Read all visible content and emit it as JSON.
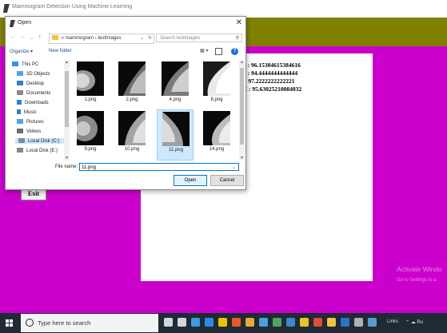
{
  "app": {
    "title": "Mammogram Detection Using Machine Learning"
  },
  "results": [
    {
      "prefix": "y",
      "value": ": 96.15384615384616"
    },
    {
      "prefix": "a",
      "value": ": 94.4444444444444"
    },
    {
      "prefix": "",
      "value": ": 97.2222222222221"
    },
    {
      "prefix": "E",
      "value": ": 95.63025210084032"
    }
  ],
  "exit_label": "Exit",
  "watermark": {
    "line1": "Activate Windo",
    "line2": "Go to Settings to a"
  },
  "dialog": {
    "title": "Open",
    "close": "✕",
    "breadcrumb": [
      "«",
      "mammogram",
      "›",
      "testImages"
    ],
    "search_placeholder": "Search testImages",
    "organize": "Organize ▾",
    "new_folder": "New folder",
    "nav_items": [
      {
        "label": "This PC",
        "color": "#3a8ee6"
      },
      {
        "label": "3D Objects",
        "color": "#4aa8e0"
      },
      {
        "label": "Desktop",
        "color": "#2f7fd8"
      },
      {
        "label": "Documents",
        "color": "#8a8a8a"
      },
      {
        "label": "Downloads",
        "color": "#2f7fd8"
      },
      {
        "label": "Music",
        "color": "#2f7fd8"
      },
      {
        "label": "Pictures",
        "color": "#5aa0e0"
      },
      {
        "label": "Videos",
        "color": "#6b6b6b"
      },
      {
        "label": "Local Disk (C:)",
        "color": "#888888"
      },
      {
        "label": "Local Disk (E:)",
        "color": "#888888"
      }
    ],
    "files": [
      {
        "name": "1.png",
        "selected": false
      },
      {
        "name": "2.png",
        "selected": false
      },
      {
        "name": "4.png",
        "selected": false
      },
      {
        "name": "8.png",
        "selected": false
      },
      {
        "name": "9.png",
        "selected": false
      },
      {
        "name": "10.png",
        "selected": false
      },
      {
        "name": "11.png",
        "selected": true
      },
      {
        "name": "14.png",
        "selected": false
      }
    ],
    "file_name_label": "File name:",
    "file_name_value": "11.png",
    "open_label": "Open",
    "cancel_label": "Cancel"
  },
  "taskbar": {
    "search_placeholder": "Type here to search",
    "tray_links": "Links",
    "tray_right": "⌃ ☁ Ru",
    "icons": [
      {
        "name": "mic-icon",
        "color": "#cfd6dd"
      },
      {
        "name": "task-view-icon",
        "color": "#cfd6dd"
      },
      {
        "name": "edge-icon",
        "color": "#3b9be8"
      },
      {
        "name": "ie-icon",
        "color": "#2e8be0"
      },
      {
        "name": "store-icon",
        "color": "#f0c000"
      },
      {
        "name": "security-icon",
        "color": "#e8572a"
      },
      {
        "name": "chrome-icon",
        "color": "#e8a93a"
      },
      {
        "name": "chrome2-icon",
        "color": "#46a3d9"
      },
      {
        "name": "terminal-icon",
        "color": "#4fa35f"
      },
      {
        "name": "paint-icon",
        "color": "#3d86c7"
      },
      {
        "name": "python-icon",
        "color": "#e9c32a"
      },
      {
        "name": "media-icon",
        "color": "#df4b3c"
      },
      {
        "name": "explorer-icon",
        "color": "#f3c23c"
      },
      {
        "name": "editor-icon",
        "color": "#2b73c9"
      },
      {
        "name": "idle-icon",
        "color": "#b0b0b0"
      },
      {
        "name": "pinned-app-icon",
        "color": "#5b9bd5"
      }
    ]
  }
}
